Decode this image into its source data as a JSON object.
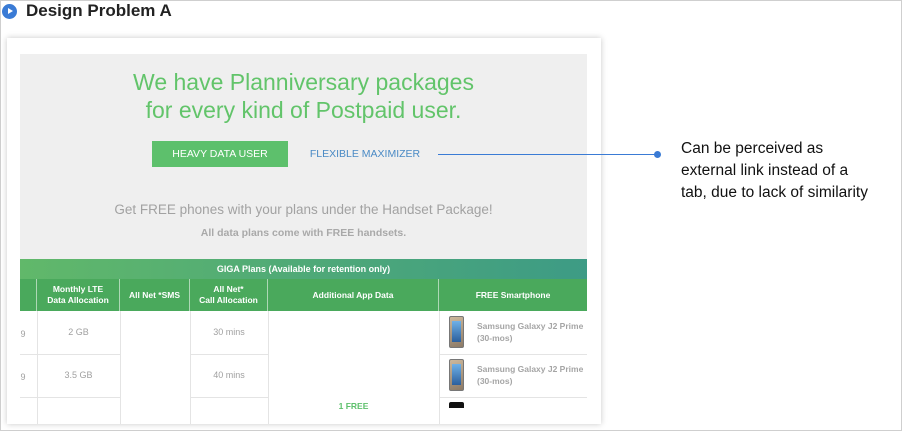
{
  "heading": {
    "title": "Design Problem A",
    "icon": "play-circle-icon"
  },
  "hero": {
    "title_line1": "We have Planniversary packages",
    "title_line2": "for every kind of Postpaid user.",
    "tabs": [
      {
        "label": "HEAVY DATA USER"
      },
      {
        "label": "FLEXIBLE MAXIMIZER"
      }
    ],
    "promo": "Get FREE phones with your plans under the Handset Package!",
    "promo_sub": "All data plans come with FREE handsets."
  },
  "table": {
    "title": "GIGA Plans (Available for retention only)",
    "headers": {
      "data_line1": "Monthly LTE",
      "data_line2": "Data Allocation",
      "sms": "All Net *SMS",
      "call_line1": "All Net*",
      "call_line2": "Call Allocation",
      "app": "Additional App Data",
      "phone": "FREE Smartphone"
    },
    "rows": [
      {
        "prefix": "9",
        "data": "2 GB",
        "call": "30 mins",
        "phone_line1": "Samsung Galaxy J2 Prime",
        "phone_line2": "(30-mos)"
      },
      {
        "prefix": "9",
        "data": "3.5 GB",
        "call": "40 mins",
        "phone_line1": "Samsung Galaxy J2 Prime",
        "phone_line2": "(30-mos)"
      }
    ],
    "app_value": "1 FREE"
  },
  "callout": {
    "line1": "Can be perceived as",
    "line2": "external link instead of a",
    "line3": "tab, due to lack of similarity"
  },
  "colors": {
    "accent_green": "#5dc06c",
    "link_blue": "#4a8ac5",
    "annotation_blue": "#3a7bd5"
  }
}
